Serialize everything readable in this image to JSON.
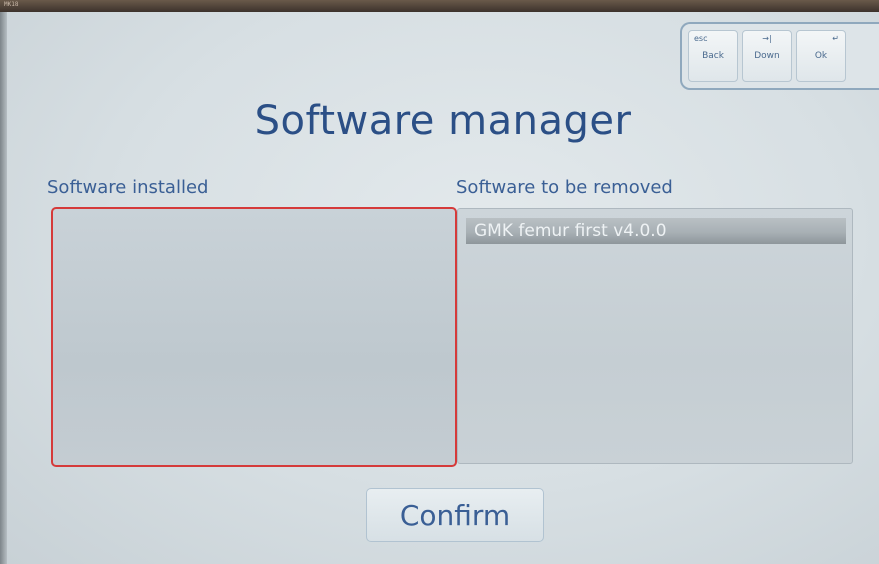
{
  "bezel": {
    "tag": "MK18"
  },
  "keys": {
    "back": {
      "top": "esc",
      "label": "Back"
    },
    "down": {
      "top": "→|",
      "label": "Down"
    },
    "ok": {
      "top": "↵",
      "label": "Ok"
    }
  },
  "title": "Software manager",
  "installed": {
    "label": "Software installed",
    "items": []
  },
  "removed": {
    "label": "Software to be removed",
    "items": [
      "GMK femur first v4.0.0"
    ]
  },
  "confirm_label": "Confirm",
  "colors": {
    "accent": "#2b4f86",
    "focus_border": "#d53a3a"
  }
}
